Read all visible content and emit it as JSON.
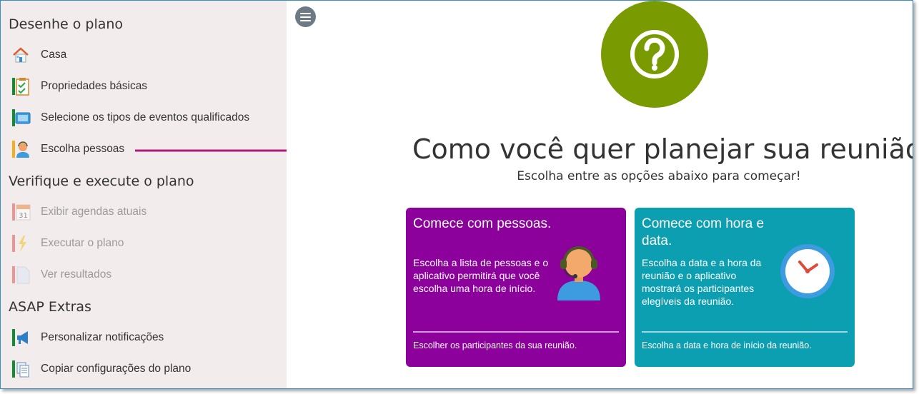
{
  "sidebar": {
    "sections": [
      {
        "title": "Desenhe o plano",
        "items": [
          {
            "label": "Casa",
            "icon": "house-icon",
            "disabled": false
          },
          {
            "label": "Propriedades básicas",
            "icon": "clipboard-check-icon",
            "disabled": false
          },
          {
            "label": "Selecione os tipos de eventos qualificados",
            "icon": "calendar-screen-icon",
            "disabled": false
          },
          {
            "label": "Escolha pessoas",
            "icon": "person-icon",
            "disabled": false
          }
        ]
      },
      {
        "title": "Verifique e execute o plano",
        "items": [
          {
            "label": "Exibir agendas atuais",
            "icon": "calendar-31-icon",
            "disabled": true
          },
          {
            "label": "Executar o plano",
            "icon": "lightning-icon",
            "disabled": true
          },
          {
            "label": "Ver resultados",
            "icon": "document-icon",
            "disabled": true
          }
        ]
      },
      {
        "title": "ASAP Extras",
        "items": [
          {
            "label": "Personalizar notificações",
            "icon": "megaphone-icon",
            "disabled": false
          },
          {
            "label": "Copiar configurações do plano",
            "icon": "copy-document-icon",
            "disabled": false
          }
        ]
      }
    ]
  },
  "main": {
    "menu_icon": "hamburger-menu-icon",
    "help_icon": "question-mark-icon",
    "headline": "Como você quer planejar sua reunião?",
    "subheadline": "Escolha entre as opções abaixo para começar!",
    "cards": [
      {
        "title": "Comece com pessoas.",
        "description": "Escolha a lista de pessoas e o aplicativo permitirá que você escolha uma hora de início.",
        "footer": "Escolher os participantes da sua reunião.",
        "icon": "person-headset-icon",
        "color": "#8c009c"
      },
      {
        "title": "Comece com hora e data.",
        "description": "Escolha a data e a hora da reunião e o aplicativo mostrará os participantes elegíveis da reunião.",
        "footer": "Escolha a data e hora de início da reunião.",
        "icon": "clock-icon",
        "color": "#0c9fb2"
      }
    ]
  },
  "colors": {
    "sidebar_bg": "#f3ecec",
    "help_circle": "#7a9a01",
    "annotation_arrow": "#b5167a"
  }
}
